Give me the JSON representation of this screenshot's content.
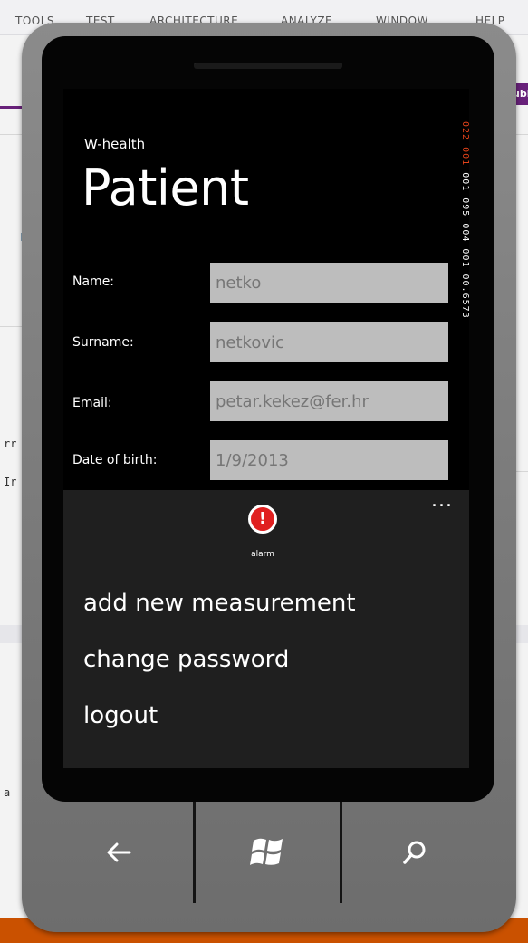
{
  "ide": {
    "menu": [
      "TOOLS",
      "TEST",
      "ARCHITECTURE",
      "ANALYZE",
      "WINDOW",
      "HELP"
    ],
    "right_tab": "ubl",
    "fragment_1": "rr",
    "fragment_2": "Ir",
    "fragment_3": "a",
    "fragment_4": "P"
  },
  "debug_counter": {
    "red_part": "022 001",
    "white_part": "001 095 004 001 00.6573"
  },
  "app": {
    "title": "W-health",
    "page_title": "Patient",
    "fields": [
      {
        "label": "Name:",
        "value": "netko"
      },
      {
        "label": "Surname:",
        "value": "netkovic"
      },
      {
        "label": "Email:",
        "value": "petar.kekez@fer.hr"
      },
      {
        "label": "Date of birth:",
        "value": "1/9/2013"
      }
    ]
  },
  "appbar": {
    "more": "...",
    "alarm_label": "alarm",
    "menu_items": [
      "add new measurement",
      "change password",
      "logout"
    ]
  },
  "hardware": {
    "back_icon": "back-arrow-icon",
    "start_icon": "windows-logo-icon",
    "search_icon": "search-icon"
  },
  "colors": {
    "accent_alarm": "#e02020",
    "ide_accent": "#68217a",
    "status_bar": "#ca5100"
  }
}
